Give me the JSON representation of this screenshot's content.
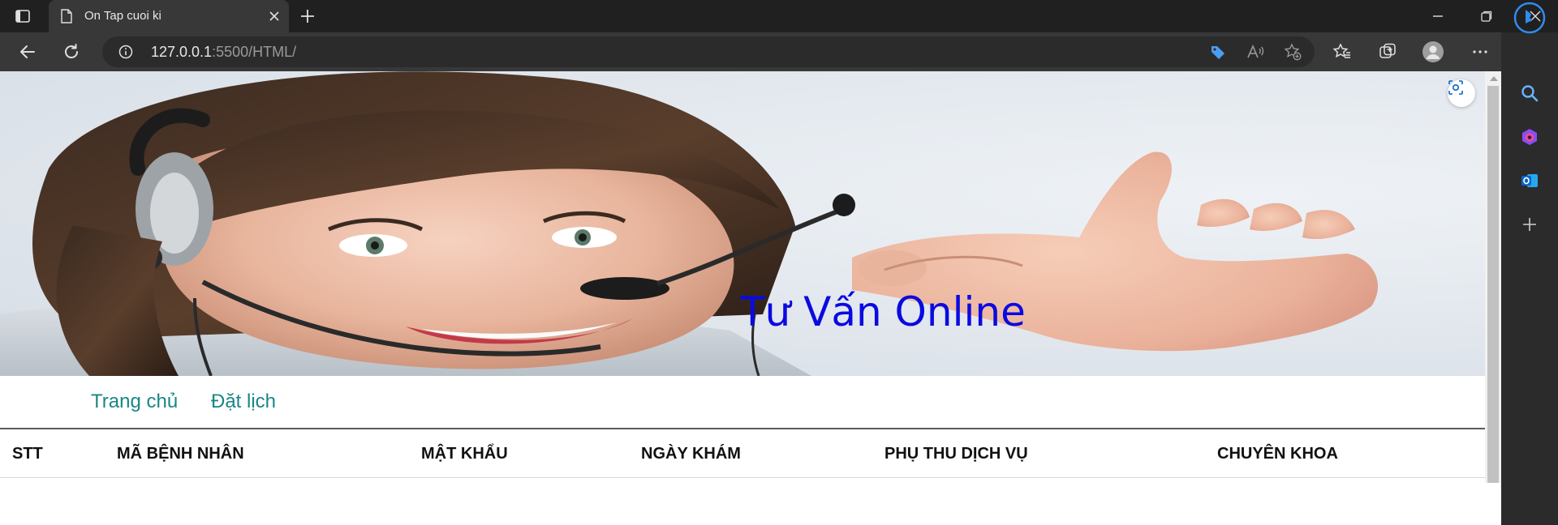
{
  "browser": {
    "tab_title": "On Tap cuoi ki",
    "url_host": "127.0.0.1",
    "url_rest": ":5500/HTML/"
  },
  "icons": {
    "tab_actions": "tab-actions-icon",
    "page": "page-icon",
    "close": "close-icon",
    "new_tab": "plus-icon",
    "minimize": "minimize-icon",
    "restore": "restore-icon",
    "window_close": "close-icon",
    "back": "back-arrow-icon",
    "refresh": "refresh-icon",
    "info": "info-icon",
    "coupon": "tag-icon",
    "read_aloud": "read-aloud-icon",
    "add_favorite": "star-add-icon",
    "favorites": "favorites-icon",
    "collections": "collections-icon",
    "profile": "profile-icon",
    "more": "more-icon",
    "copilot": "copilot-icon",
    "search": "search-icon",
    "office": "office-icon",
    "outlook": "outlook-icon",
    "add": "plus-icon",
    "visual_search": "visual-search-icon"
  },
  "page": {
    "banner_title": "Tư Vấn Online",
    "nav": [
      "Trang chủ",
      "Đặt lịch"
    ],
    "table_headers": [
      "STT",
      "MÃ BỆNH NHÂN",
      "MẬT KHẨU",
      "NGÀY KHÁM",
      "PHỤ THU DỊCH VỤ",
      "CHUYÊN KHOA"
    ]
  },
  "colors": {
    "banner_title": "#0a0ae0",
    "nav_link": "#1a8686",
    "chrome_dark": "#202020",
    "toolbar": "#383838"
  }
}
